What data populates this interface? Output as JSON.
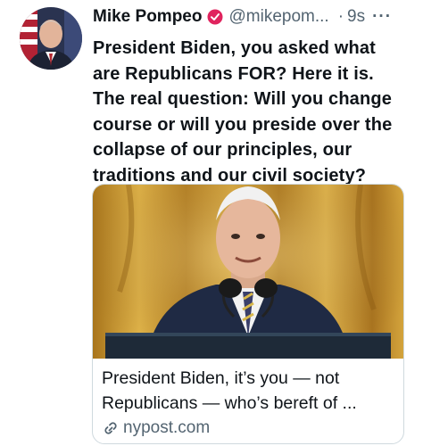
{
  "tweet": {
    "author_name": "Mike Pompeo",
    "handle": "@mikepom...",
    "separator": "·",
    "time": "9s",
    "more": "···",
    "text": "President Biden, you asked what\nare Republicans FOR? Here it is.\nThe real question:  Will you change\ncourse or will you preside over the\ncollapse of our principles, our\ntraditions and our civil society?",
    "card": {
      "title_line1": "President Biden, it’s you — not",
      "title_line2": "Republicans — who’s bereft of ...",
      "domain": "nypost.com"
    }
  },
  "icons": {
    "verified": "verified-badge-icon",
    "more": "more-dots-icon",
    "link": "link-icon"
  },
  "colors": {
    "text": "#0f1419",
    "secondary": "#536471",
    "verified_badge": "#e0245e",
    "card_border": "#cfd9de",
    "curtain_gold": "#c99a2e"
  }
}
